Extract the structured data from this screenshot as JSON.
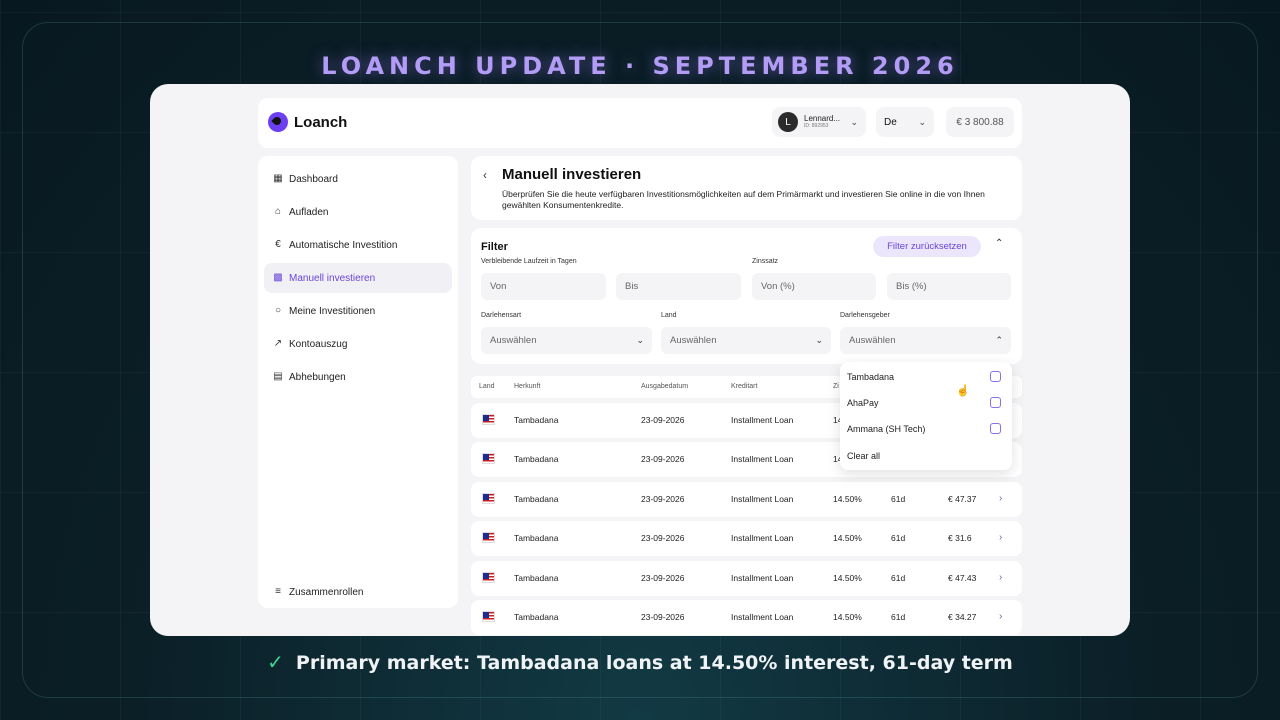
{
  "headline": "LOANCH UPDATE · SEPTEMBER 2026",
  "caption": "Primary market: Tambadana loans at 14.50% interest, 61-day term",
  "caption_icon": "check-icon",
  "colors": {
    "accent": "#6a45d8",
    "headline": "#b39cf5",
    "check": "#3dd68c"
  },
  "app": {
    "logo": "Loanch",
    "user": {
      "initial": "L",
      "name": "Lennard...",
      "id": "ID: 892953"
    },
    "language": "De",
    "balance": "€ 3 800.88"
  },
  "sidebar": {
    "items": [
      {
        "label": "Dashboard",
        "icon": "dashboard-icon"
      },
      {
        "label": "Aufladen",
        "icon": "bank-icon"
      },
      {
        "label": "Automatische Investition",
        "icon": "euro-icon"
      },
      {
        "label": "Manuell investieren",
        "icon": "manual-invest-icon",
        "active": true
      },
      {
        "label": "Meine Investitionen",
        "icon": "piggy-bank-icon"
      },
      {
        "label": "Kontoauszug",
        "icon": "chart-icon"
      },
      {
        "label": "Abhebungen",
        "icon": "cash-icon"
      }
    ],
    "collapse_label": "Zusammenrollen"
  },
  "page": {
    "title": "Manuell investieren",
    "description": "Überprüfen Sie die heute verfügbaren Investitionsmöglichkeiten auf dem Primärmarkt und investieren Sie online in die von Ihnen gewählten Konsumentenkredite."
  },
  "filter": {
    "title": "Filter",
    "reset_label": "Filter zurücksetzen",
    "term_label": "Verbleibende Laufzeit in Tagen",
    "rate_label": "Zinssatz",
    "term_from": "Von",
    "term_to": "Bis",
    "rate_from": "Von (%)",
    "rate_to": "Bis (%)",
    "loan_type_label": "Darlehensart",
    "country_label": "Land",
    "lender_label": "Darlehensgeber",
    "select_placeholder": "Auswählen"
  },
  "dropdown": {
    "options": [
      "Tambadana",
      "AhaPay",
      "Ammana (SH Tech)"
    ],
    "clear_label": "Clear all"
  },
  "table": {
    "headers": {
      "country": "Land",
      "origin": "Herkunft",
      "date": "Ausgabedatum",
      "type": "Kreditart",
      "rate": "Zi"
    },
    "rows": [
      {
        "origin": "Tambadana",
        "date": "23-09-2026",
        "type": "Installment Loan",
        "rate": "14",
        "term": "",
        "amount": ""
      },
      {
        "origin": "Tambadana",
        "date": "23-09-2026",
        "type": "Installment Loan",
        "rate": "14",
        "term": "",
        "amount": ""
      },
      {
        "origin": "Tambadana",
        "date": "23-09-2026",
        "type": "Installment Loan",
        "rate": "14.50%",
        "term": "61d",
        "amount": "€ 47.37"
      },
      {
        "origin": "Tambadana",
        "date": "23-09-2026",
        "type": "Installment Loan",
        "rate": "14.50%",
        "term": "61d",
        "amount": "€ 31.6"
      },
      {
        "origin": "Tambadana",
        "date": "23-09-2026",
        "type": "Installment Loan",
        "rate": "14.50%",
        "term": "61d",
        "amount": "€ 47.43"
      },
      {
        "origin": "Tambadana",
        "date": "23-09-2026",
        "type": "Installment Loan",
        "rate": "14.50%",
        "term": "61d",
        "amount": "€ 34.27"
      }
    ]
  }
}
